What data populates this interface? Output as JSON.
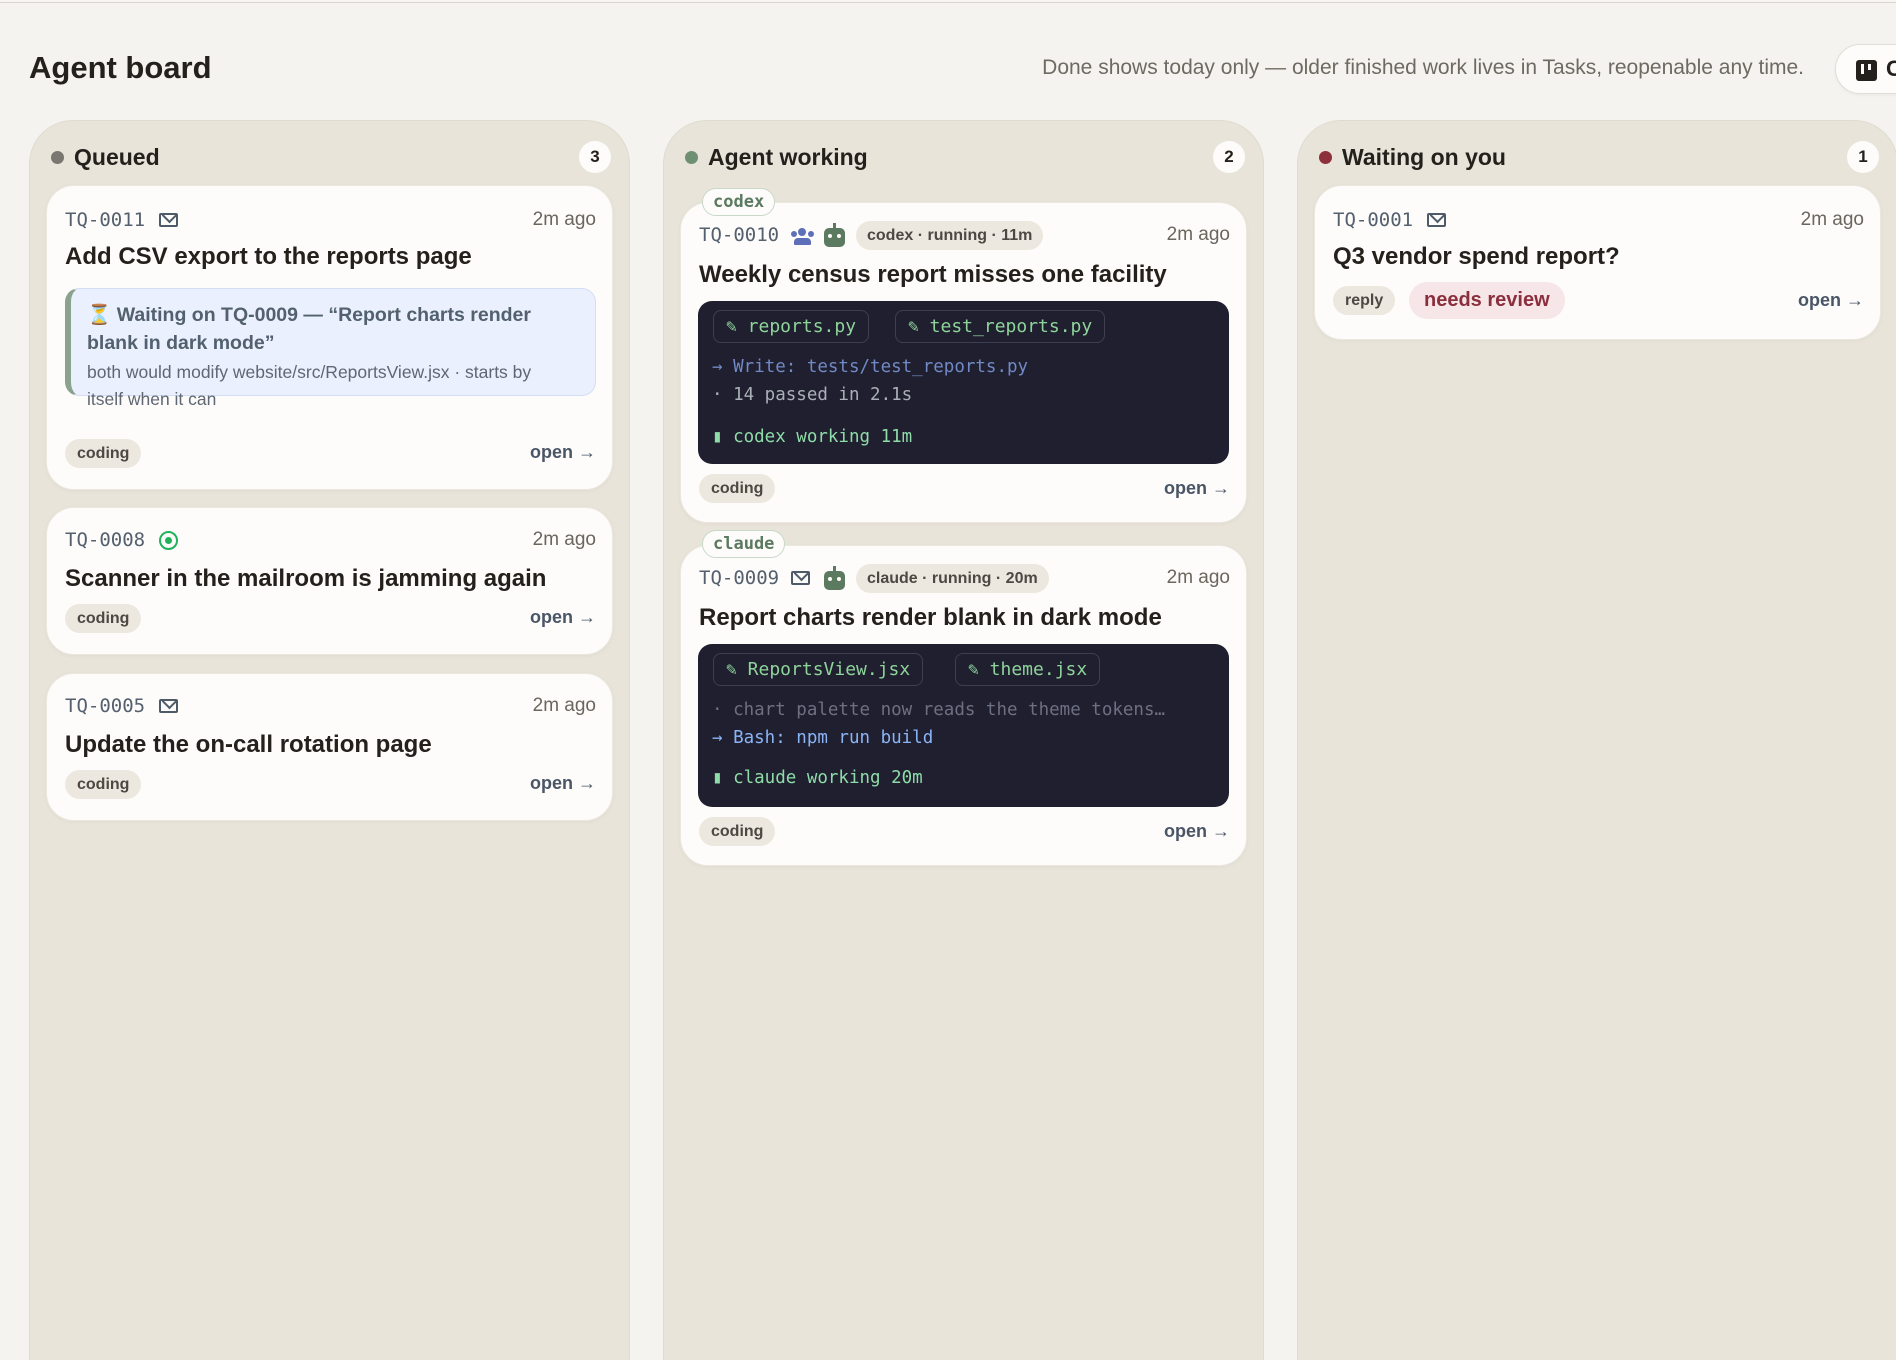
{
  "header": {
    "title": "Agent board",
    "note": "Done shows today only — older finished work lives in Tasks, reopenable any time.",
    "view_toggle_label": "C"
  },
  "colors": {
    "queued_dot": "#7a7670",
    "working_dot": "#6e8f72",
    "waiting_dot": "#8e2f3c"
  },
  "columns": [
    {
      "title": "Queued",
      "count": "3",
      "cards": [
        {
          "id": "TQ-0011",
          "channel_icon": "mail-icon",
          "time": "2m ago",
          "title": "Add CSV export to the reports page",
          "blocked": {
            "icon": "⏳",
            "headline": "Waiting on TQ-0009 — “Report charts render blank in dark mode”",
            "detail": "both would modify website/src/ReportsView.jsx · starts by itself when it can"
          },
          "tag": "coding",
          "open": "open →"
        },
        {
          "id": "TQ-0008",
          "channel_icon": "whatsapp-icon",
          "time": "2m ago",
          "title": "Scanner in the mailroom is jamming again",
          "tag": "coding",
          "open": "open →"
        },
        {
          "id": "TQ-0005",
          "channel_icon": "mail-icon",
          "time": "2m ago",
          "title": "Update the on-call rotation page",
          "tag": "coding",
          "open": "open →"
        }
      ]
    },
    {
      "title": "Agent working",
      "count": "2",
      "cards": [
        {
          "agent": "codex",
          "id": "TQ-0010",
          "channel_icon": "people-icon",
          "agent_icon": "robot-icon",
          "run_status": "codex · running · 11m",
          "time": "2m ago",
          "title": "Weekly census report misses one facility",
          "files": [
            "✎ reports.py",
            "✎ test_reports.py"
          ],
          "log": [
            "→ Write: tests/test_reports.py",
            "· 14 passed in 2.1s"
          ],
          "status": "▮ codex working 11m",
          "tag": "coding",
          "open": "open →"
        },
        {
          "agent": "claude",
          "id": "TQ-0009",
          "channel_icon": "mail-icon",
          "agent_icon": "robot-icon",
          "run_status": "claude · running · 20m",
          "time": "2m ago",
          "title": "Report charts render blank in dark mode",
          "files": [
            "✎ ReportsView.jsx",
            "✎ theme.jsx"
          ],
          "log": [
            "· chart palette now reads the theme tokens…",
            "→ Bash: npm run build"
          ],
          "status": "▮ claude working 20m",
          "tag": "coding",
          "open": "open →"
        }
      ]
    },
    {
      "title": "Waiting on you",
      "count": "1",
      "cards": [
        {
          "id": "TQ-0001",
          "channel_icon": "mail-icon",
          "time": "2m ago",
          "title": "Q3 vendor spend report?",
          "tag": "reply",
          "badge": "needs review",
          "open": "open →"
        }
      ]
    }
  ]
}
